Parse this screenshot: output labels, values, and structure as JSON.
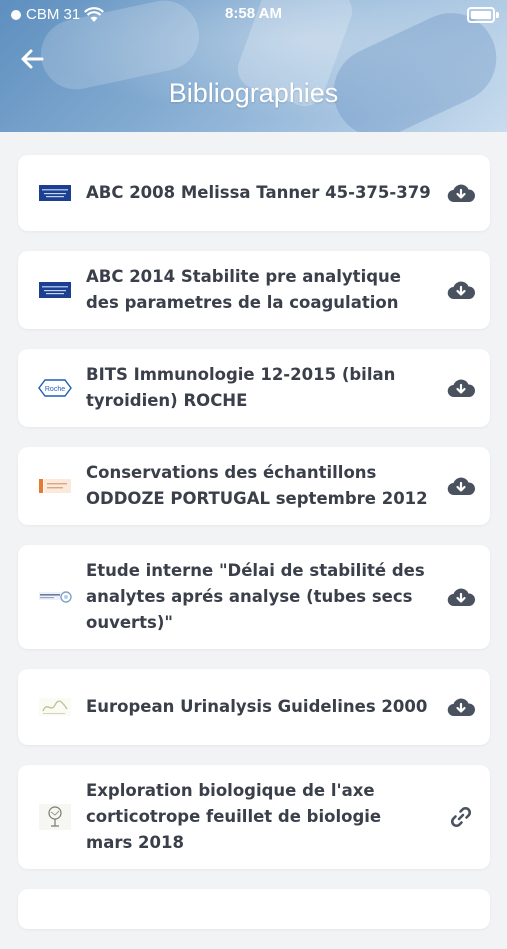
{
  "status_bar": {
    "carrier": "CBM 31",
    "time": "8:58 AM"
  },
  "header": {
    "title": "Bibliographies"
  },
  "items": [
    {
      "title": "ABC 2008 Melissa Tanner 45-375-379",
      "logo": "blue-journal-logo",
      "action": "download-cloud-icon"
    },
    {
      "title": "ABC 2014 Stabilite pre analytique des parametres de la coagulation",
      "logo": "blue-journal-logo",
      "action": "download-cloud-icon"
    },
    {
      "title": "BITS Immunologie 12-2015 (bilan tyroidien) ROCHE",
      "logo": "roche-logo",
      "action": "download-cloud-icon",
      "logo_text": "Roche"
    },
    {
      "title": "Conservations des échantillons ODDOZE PORTUGAL septembre 2012",
      "logo": "orange-doc-logo",
      "action": "download-cloud-icon"
    },
    {
      "title": "Etude interne \"Délai de stabilité des analytes aprés analyse (tubes secs ouverts)\"",
      "logo": "biomnis-logo",
      "action": "download-cloud-icon"
    },
    {
      "title": "European Urinalysis Guidelines 2000",
      "logo": "guidelines-logo",
      "action": "download-cloud-icon"
    },
    {
      "title": "Exploration biologique de l'axe corticotrope feuillet de biologie mars 2018",
      "logo": "tree-logo",
      "action": "link-icon"
    },
    {
      "title": "",
      "logo": "",
      "action": ""
    }
  ],
  "colors": {
    "accent": "#4a5260",
    "text": "#3a3f4a"
  }
}
